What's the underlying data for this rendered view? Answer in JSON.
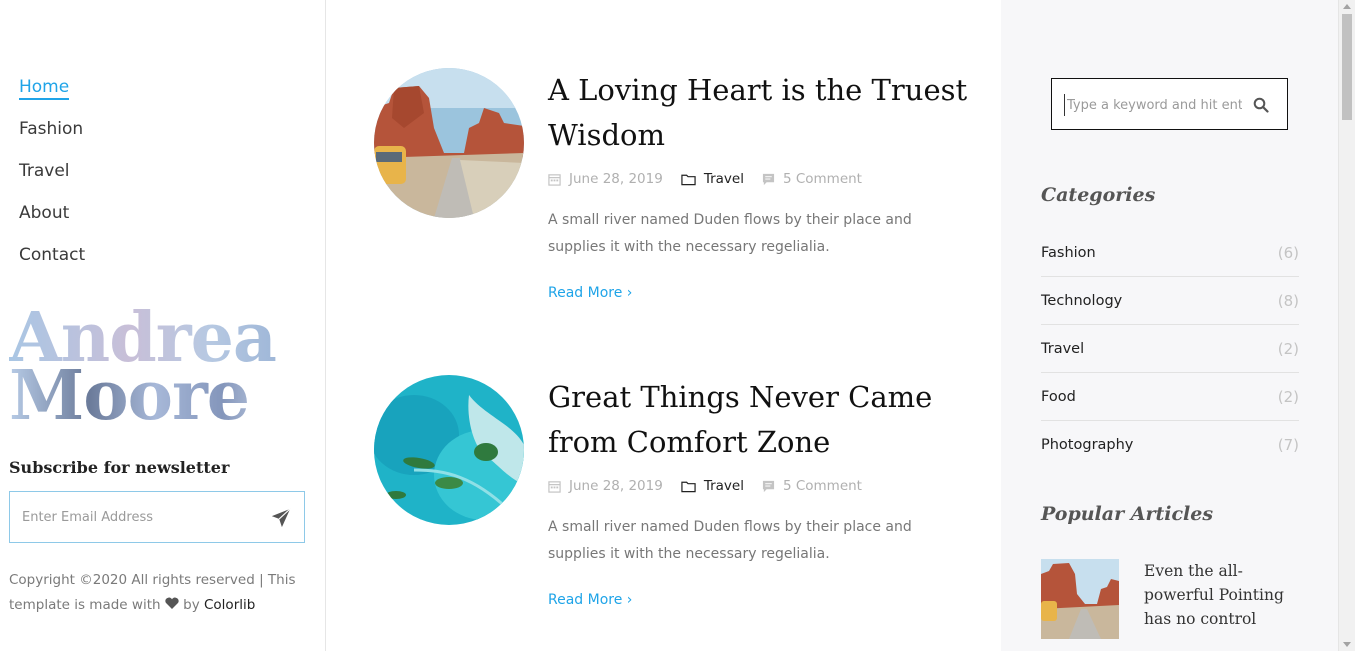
{
  "nav": {
    "items": [
      {
        "label": "Home",
        "active": true
      },
      {
        "label": "Fashion",
        "active": false
      },
      {
        "label": "Travel",
        "active": false
      },
      {
        "label": "About",
        "active": false
      },
      {
        "label": "Contact",
        "active": false
      }
    ]
  },
  "logo": {
    "line1": "Andrea",
    "line2": "Moore"
  },
  "subscribe": {
    "title": "Subscribe for newsletter",
    "placeholder": "Enter Email Address",
    "icon": "paper-plane-icon"
  },
  "footer": {
    "copyright_prefix": "Copyright ©2020 All rights reserved | This template is made with",
    "by": "by",
    "brand": "Colorlib",
    "icon": "heart-icon"
  },
  "posts": [
    {
      "title": "A Loving Heart is the Truest Wisdom",
      "date": "June 28, 2019",
      "category": "Travel",
      "comments": "5 Comment",
      "excerpt": "A small river named Duden flows by their place and supplies it with the necessary regelialia.",
      "read_more": "Read More",
      "image": "desert-road-photo"
    },
    {
      "title": "Great Things Never Came from Comfort Zone",
      "date": "June 28, 2019",
      "category": "Travel",
      "comments": "5 Comment",
      "excerpt": "A small river named Duden flows by their place and supplies it with the necessary regelialia.",
      "read_more": "Read More",
      "image": "tropical-island-aerial-photo"
    }
  ],
  "sidebar": {
    "search_placeholder": "Type a keyword and hit enter",
    "categories_heading": "Categories",
    "categories": [
      {
        "name": "Fashion",
        "count": "(6)"
      },
      {
        "name": "Technology",
        "count": "(8)"
      },
      {
        "name": "Travel",
        "count": "(2)"
      },
      {
        "name": "Food",
        "count": "(2)"
      },
      {
        "name": "Photography",
        "count": "(7)"
      }
    ],
    "popular_heading": "Popular Articles",
    "popular": [
      {
        "title": "Even the all-powerful Pointing has no control"
      }
    ]
  },
  "colors": {
    "accent": "#1fa4e8",
    "sidebar_bg": "#f7f7f9",
    "count": "#c4c4c4"
  }
}
